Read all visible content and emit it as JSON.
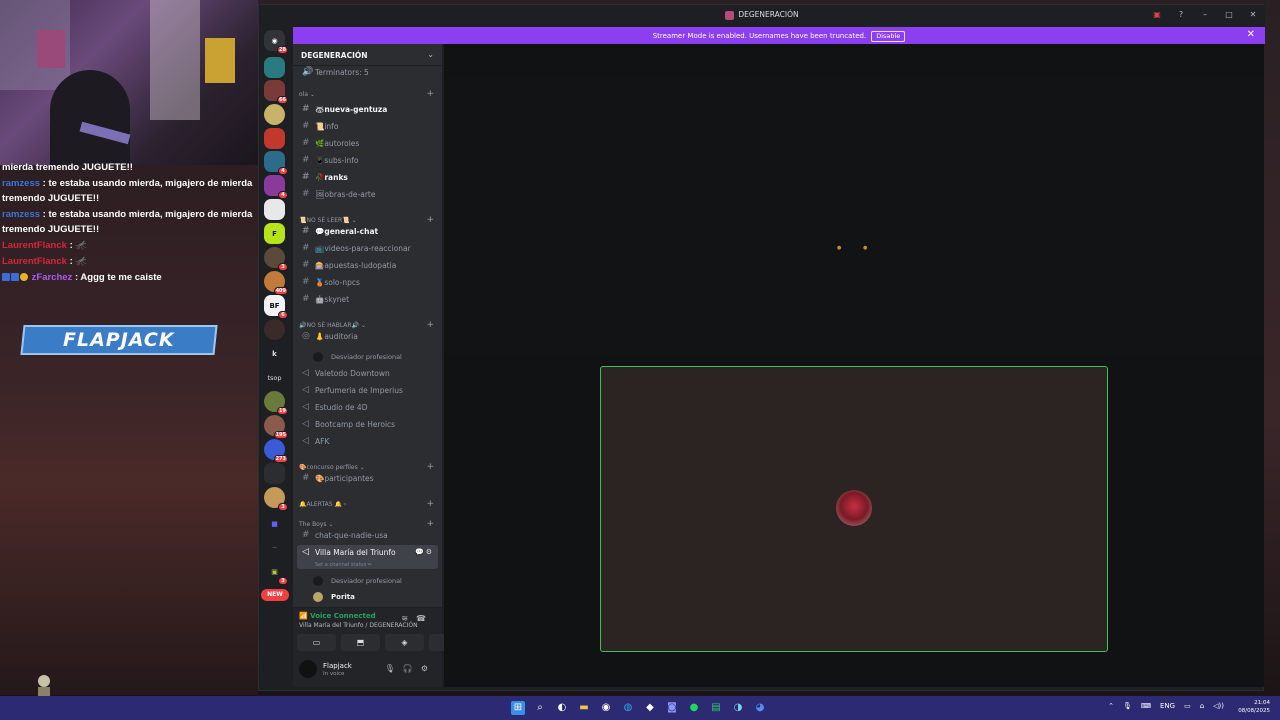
{
  "stream": {
    "chat": [
      {
        "user": "",
        "sep": "",
        "text": "mierda tremendo JUGUETE!!"
      },
      {
        "user": "ramzess",
        "sep": ":",
        "text": "te estaba usando mierda, migajero de mierda tremendo JUGUETE!!"
      },
      {
        "user": "ramzess",
        "sep": ":",
        "text": "te estaba usando mierda, migajero de mierda tremendo JUGUETE!!"
      },
      {
        "user": "LaurentFlanck",
        "sep": ":",
        "text": "🦟"
      },
      {
        "user": "LaurentFlanck",
        "sep": ":",
        "text": "🦟"
      },
      {
        "user": "zFarchez",
        "sep": ":",
        "text": "Aggg te me caiste"
      }
    ],
    "banner": "FLAPJACK"
  },
  "window": {
    "title": "DEGENERACIÓN",
    "notice_text": "Streamer Mode is enabled. Usernames have been truncated.",
    "notice_button": "Disable"
  },
  "rail": {
    "badges": [
      "28",
      "66",
      "4",
      "4",
      "3",
      "409",
      "6",
      "19",
      "195",
      "273",
      "3",
      "3"
    ],
    "letters": {
      "k": "k",
      "tsop": "tsop",
      "bf": "BF"
    },
    "new_label": "NEW"
  },
  "guild": {
    "name": "DEGENERACIÓN",
    "top_item": "Terminators: 5",
    "cat1": "ola",
    "ch_nueva": "🦝nueva-gentuza",
    "ch_info": "📜info",
    "ch_autoroles": "🌿autoroles",
    "ch_subs": "📱subs-info",
    "ch_ranks": "🥀ranks",
    "ch_obras": "🖼obras-de-arte",
    "cat2": "📜NO SÉ LEER📜",
    "ch_general": "💬general-chat",
    "ch_videos": "📺videos-para-reaccionar",
    "ch_apuestas": "🎰apuestas-ludopatia",
    "ch_solo": "🥉solo-npcs",
    "ch_skynet": "🤖skynet",
    "cat3": "🔊NO SÉ HABLAR🔊",
    "vc_auditoria": "👃auditoria",
    "u_desviador1": "Desviador profesional",
    "vc_valetodo": "Valetodo Downtown",
    "vc_perfumeria": "Perfumeria de Imperius",
    "vc_estudio": "Estudio de 4D",
    "vc_bootcamp": "Bootcamp de Heroics",
    "vc_afk": "AFK",
    "cat4": "🎨concurso perfiles",
    "ch_participantes": "🎨participantes",
    "cat5": "🔔ALERTAS 🔔",
    "cat6": "The Boys",
    "vc_chat_nadie": "chat-que-nadie-usa",
    "vc_villa": "Villa María del Triunfo",
    "vc_status": "Set a channel status ✏",
    "u_desviador2": "Desviador profesional",
    "u_porita": "Porita"
  },
  "voice": {
    "connected": "Voice Connected",
    "where": "Villa María del Triunfo / DEGENERACIÓN"
  },
  "user": {
    "name": "Flapjack",
    "status": "In voice"
  },
  "taskbar": {
    "lang": "ENG",
    "time": "21:04",
    "date": "08/08/2025"
  }
}
